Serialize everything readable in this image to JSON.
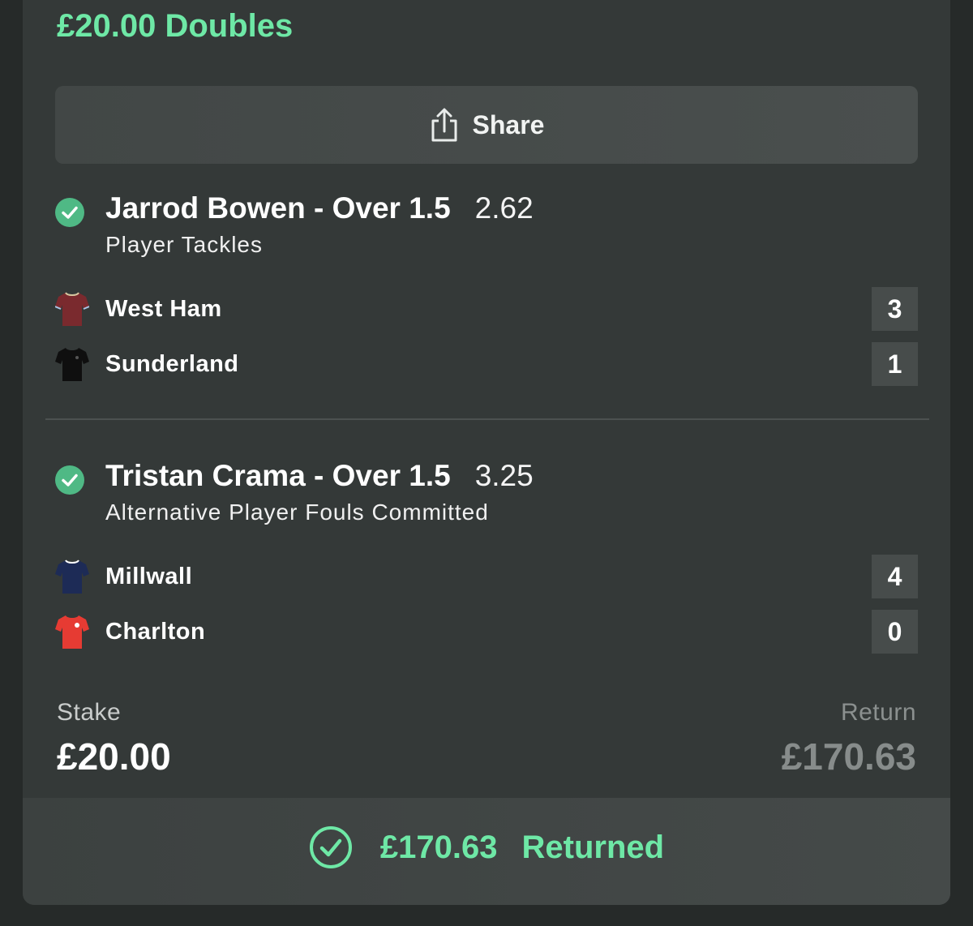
{
  "bet": {
    "title": "£20.00 Doubles",
    "share_label": "Share"
  },
  "selections": [
    {
      "name": "Jarrod Bowen - Over 1.5",
      "odds": "2.62",
      "market": "Player Tackles",
      "status_icon": "check-circle-icon",
      "teams": [
        {
          "name": "West Ham",
          "score": "3",
          "shirt_color": "#7a2a2e",
          "shirt_icon": "claret-shirt-icon"
        },
        {
          "name": "Sunderland",
          "score": "1",
          "shirt_color": "#0f0f0f",
          "shirt_icon": "black-shirt-icon"
        }
      ]
    },
    {
      "name": "Tristan Crama - Over 1.5",
      "odds": "3.25",
      "market": "Alternative Player Fouls Committed",
      "status_icon": "check-circle-icon",
      "teams": [
        {
          "name": "Millwall",
          "score": "4",
          "shirt_color": "#1d2b56",
          "shirt_icon": "navy-shirt-icon"
        },
        {
          "name": "Charlton",
          "score": "0",
          "shirt_color": "#e63b33",
          "shirt_icon": "red-shirt-icon"
        }
      ]
    }
  ],
  "summary": {
    "stake_label": "Stake",
    "stake_value": "£20.00",
    "return_label": "Return",
    "return_value": "£170.63"
  },
  "result": {
    "amount": "£170.63",
    "status": "Returned"
  },
  "colors": {
    "accent_green": "#6ee8a6",
    "check_green": "#4fb985",
    "card_bg": "#343938",
    "page_bg": "#262a29"
  }
}
